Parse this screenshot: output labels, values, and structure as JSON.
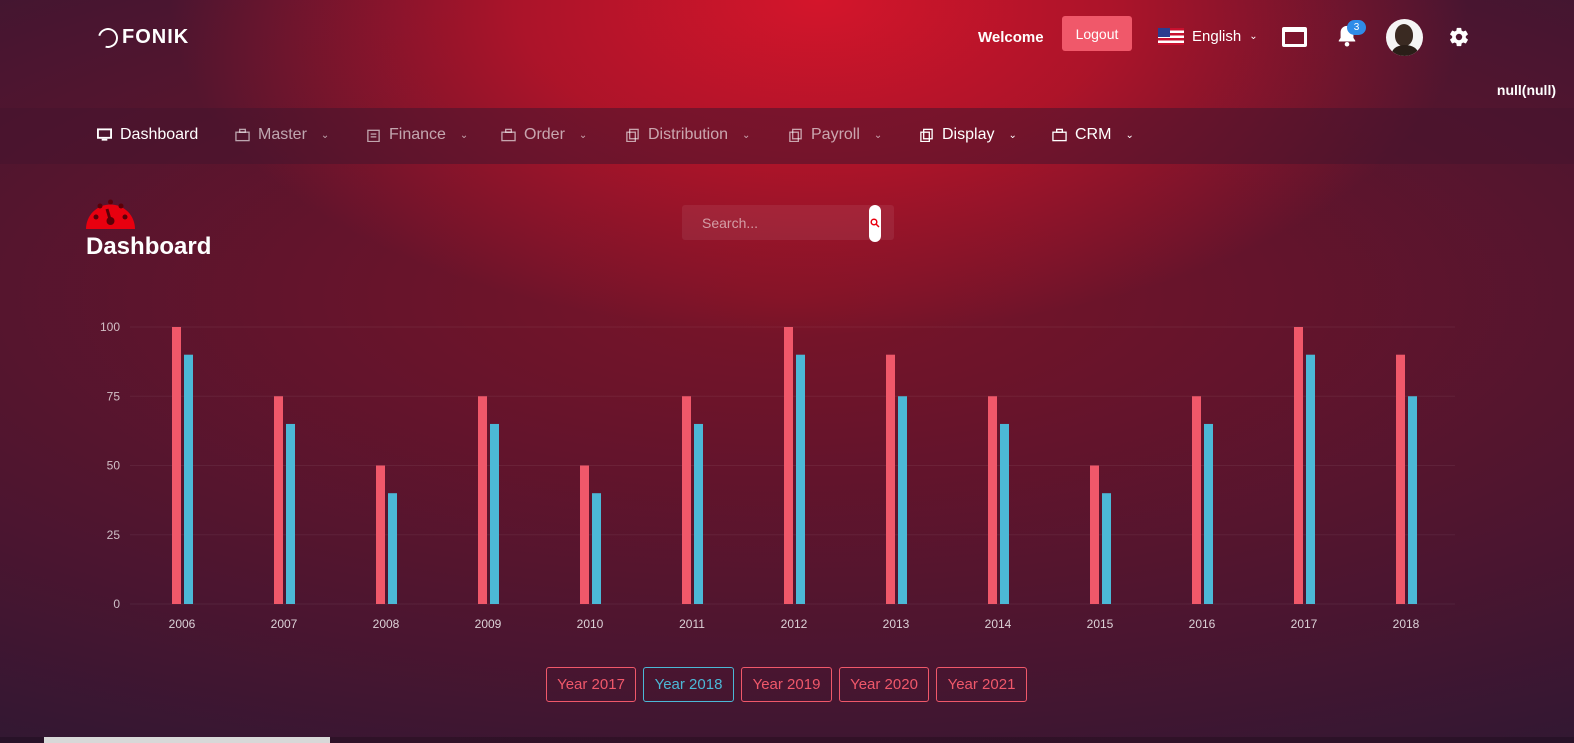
{
  "header": {
    "logo_text": "FONIK",
    "welcome": "Welcome",
    "logout_label": "Logout",
    "language": "English",
    "notification_count": "3",
    "user_label": "null(null)",
    "icons": [
      "us-flag-icon",
      "fullscreen-icon",
      "bell-icon",
      "avatar",
      "gear-icon"
    ]
  },
  "nav": {
    "items": [
      {
        "label": "Dashboard",
        "icon": "monitor-icon"
      },
      {
        "label": "Master",
        "icon": "briefcase-icon"
      },
      {
        "label": "Finance",
        "icon": "clipboard-icon"
      },
      {
        "label": "Order",
        "icon": "briefcase-icon"
      },
      {
        "label": "Distribution",
        "icon": "copy-icon"
      },
      {
        "label": "Payroll",
        "icon": "copy-icon"
      },
      {
        "label": "Display",
        "icon": "copy-icon"
      },
      {
        "label": "CRM",
        "icon": "briefcase-icon"
      }
    ]
  },
  "page": {
    "title": "Dashboard",
    "search_placeholder": "Search..."
  },
  "chart_data": {
    "type": "bar",
    "categories": [
      "2006",
      "2007",
      "2008",
      "2009",
      "2010",
      "2011",
      "2012",
      "2013",
      "2014",
      "2015",
      "2016",
      "2017",
      "2018"
    ],
    "series": [
      {
        "values": [
          100,
          75,
          50,
          75,
          50,
          75,
          100,
          90,
          75,
          50,
          75,
          100,
          90
        ],
        "color": "#f0586a"
      },
      {
        "values": [
          90,
          65,
          40,
          65,
          40,
          65,
          90,
          75,
          65,
          40,
          65,
          90,
          75
        ],
        "color": "#4cb8d6"
      }
    ],
    "yticks": [
      0,
      25,
      50,
      75,
      100
    ],
    "ylim": [
      0,
      100
    ],
    "grid": true,
    "legend": "none"
  },
  "year_buttons": [
    {
      "label": "Year 2017",
      "selected": false
    },
    {
      "label": "Year 2018",
      "selected": true
    },
    {
      "label": "Year 2019",
      "selected": false
    },
    {
      "label": "Year 2020",
      "selected": false
    },
    {
      "label": "Year 2021",
      "selected": false
    }
  ],
  "colors": {
    "accent_red": "#f0586a",
    "accent_blue": "#4cb8d6",
    "badge": "#2f8ce8"
  }
}
